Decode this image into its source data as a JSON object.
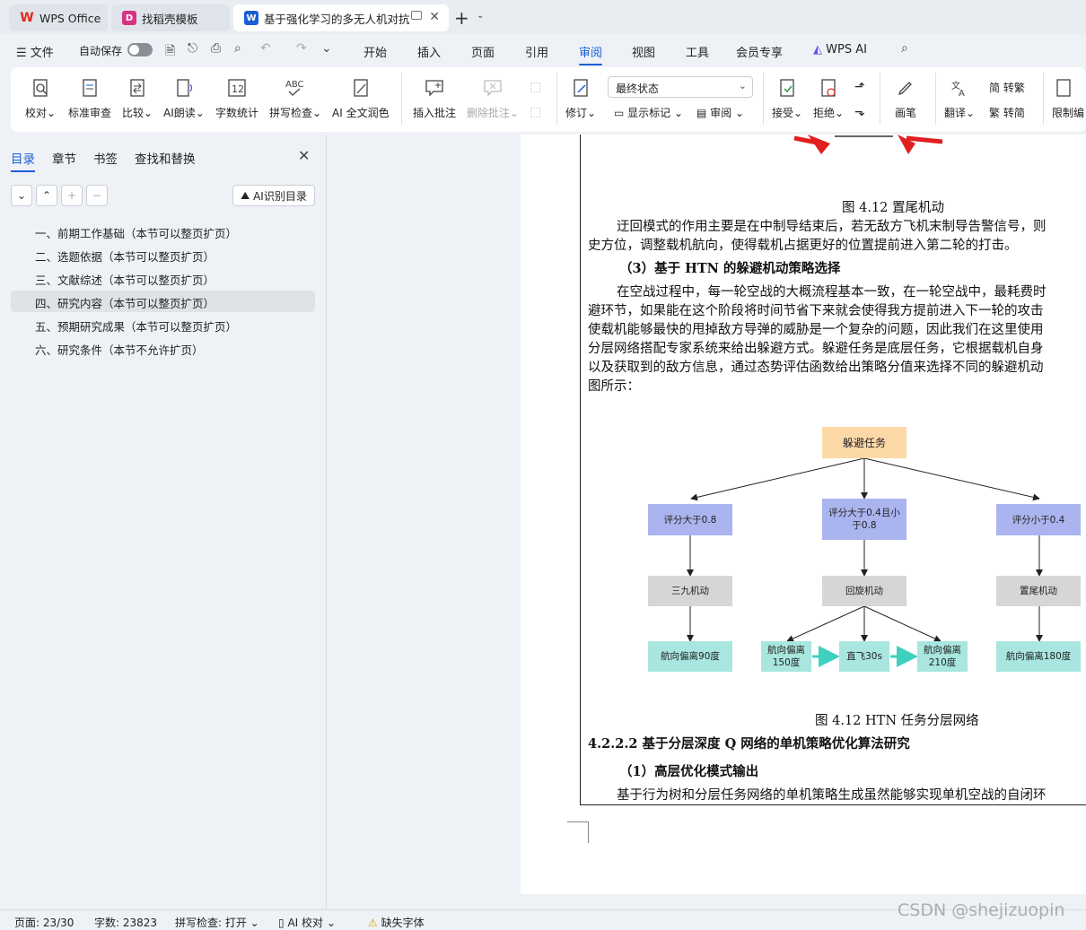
{
  "tabs": [
    {
      "label": "WPS Office",
      "icon": "wps-logo-icon",
      "color": "#e0281b"
    },
    {
      "label": "找稻壳模板",
      "icon": "docer-logo-icon",
      "color": "#d63384"
    },
    {
      "label": "基于强化学习的多无人机对抗",
      "icon": "word-doc-icon",
      "color": "#1a5fd6"
    }
  ],
  "menu": {
    "file": "文件",
    "autosave": "自动保存",
    "items": [
      "开始",
      "插入",
      "页面",
      "引用",
      "审阅",
      "视图",
      "工具",
      "会员专享",
      "WPS AI"
    ],
    "active": "审阅"
  },
  "ribbon": {
    "buttons": [
      {
        "label": "校对",
        "dd": "⌄"
      },
      {
        "label": "标准审查",
        "dd": ""
      },
      {
        "label": "比较",
        "dd": "⌄"
      },
      {
        "label": "AI朗读",
        "dd": "⌄"
      },
      {
        "label": "字数统计",
        "dd": ""
      },
      {
        "label": "拼写检查",
        "dd": "⌄"
      },
      {
        "label": "AI 全文润色",
        "dd": ""
      },
      {
        "label": "插入批注",
        "dd": ""
      },
      {
        "label": "删除批注",
        "dd": "⌄"
      },
      {
        "label": "修订",
        "dd": "⌄"
      },
      {
        "label": "接受",
        "dd": "⌄"
      },
      {
        "label": "拒绝",
        "dd": "⌄"
      },
      {
        "label": "画笔",
        "dd": ""
      },
      {
        "label": "翻译",
        "dd": "⌄"
      },
      {
        "label": "限制编",
        "dd": ""
      }
    ],
    "state_select": "最终状态",
    "show_markup": "显示标记",
    "review": "审阅",
    "trad": "转繁",
    "simp": "转简"
  },
  "nav": {
    "tabs": [
      "目录",
      "章节",
      "书签",
      "查找和替换"
    ],
    "ai_dir": "AI识别目录",
    "toc": [
      "一、前期工作基础（本节可以整页扩页）",
      "二、选题依据（本节可以整页扩页）",
      "三、文献综述（本节可以整页扩页）",
      "四、研究内容（本节可以整页扩页）",
      "五、预期研究成果（本节可以整页扩页）",
      "六、研究条件（本节不允许扩页）"
    ],
    "selected_index": 3
  },
  "doc": {
    "fig_caption_1": "图 4.12 置尾机动",
    "para1_line1": "迂回模式的作用主要是在中制导结束后，若无敌方飞机末制导告警信号，则",
    "para1_line2": "史方位，调整载机航向，使得载机占据更好的位置提前进入第二轮的打击。",
    "heading3": "（3）基于 HTN 的躲避机动策略选择",
    "para2_lines": [
      "在空战过程中，每一轮空战的大概流程基本一致，在一轮空战中，最耗费时",
      "避环节，如果能在这个阶段将时间节省下来就会使得我方提前进入下一轮的攻击",
      "使载机能够最快的甩掉敌方导弹的威胁是一个复杂的问题，因此我们在这里使用",
      "分层网络搭配专家系统来给出躲避方式。躲避任务是底层任务，它根据载机自身",
      "以及获取到的敌方信息，通过态势评估函数给出策略分值来选择不同的躲避机动",
      "图所示："
    ],
    "fig_caption_2": "图 4.12 HTN 任务分层网络",
    "heading4": "4.2.2.2 基于分层深度 Q 网络的单机策略优化算法研究",
    "heading5": "（1）高层优化模式输出",
    "para3": "基于行为树和分层任务网络的单机策略生成虽然能够实现单机空战的自闭环"
  },
  "diagram": {
    "root": "躲避任务",
    "level1": [
      "评分大于0.8",
      "评分大于0.4且小于0.8",
      "评分小于0.4"
    ],
    "level2": [
      "三九机动",
      "回旋机动",
      "置尾机动"
    ],
    "level3_left": "航向偏离90度",
    "level3_mid": [
      "航向偏离150度",
      "直飞30s",
      "航向偏离210度"
    ],
    "level3_right": "航向偏离180度",
    "colors": {
      "root": "#fdd9a8",
      "level1": "#aab4ee",
      "level2": "#d6d6d6",
      "level3": "#a8e6df",
      "arrow": "#3fd0c0"
    }
  },
  "status": {
    "page": "页面: 23/30",
    "words": "字数: 23823",
    "spell": "拼写检查: 打开",
    "ai_check": "AI 校对",
    "missing_font": "缺失字体"
  },
  "watermark": "CSDN @shejizuopin"
}
